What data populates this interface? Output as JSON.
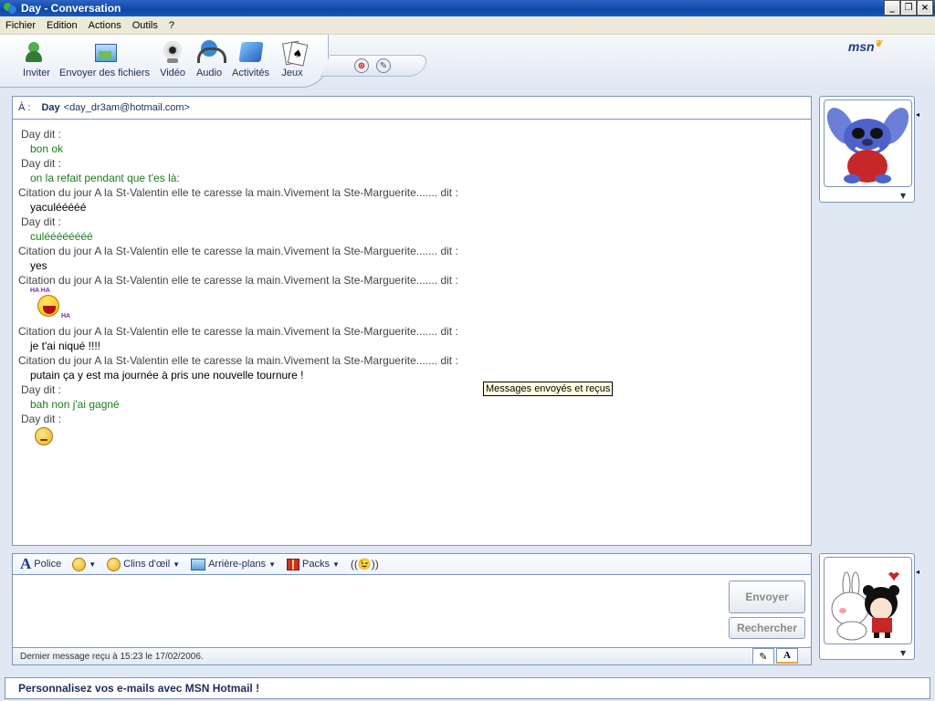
{
  "window": {
    "title": "Day - Conversation",
    "buttons": [
      "_",
      "❐",
      "×"
    ]
  },
  "menu": [
    "Fichier",
    "Edition",
    "Actions",
    "Outils",
    "?"
  ],
  "toolbar": {
    "items": [
      {
        "label": "Inviter",
        "icon": "invite-icon"
      },
      {
        "label": "Envoyer des fichiers",
        "icon": "send-files-icon"
      },
      {
        "label": "Vidéo",
        "icon": "webcam-icon"
      },
      {
        "label": "Audio",
        "icon": "headset-icon"
      },
      {
        "label": "Activités",
        "icon": "activities-icon"
      },
      {
        "label": "Jeux",
        "icon": "cards-icon"
      }
    ],
    "block_icon": "⊗",
    "pen_icon": "✎"
  },
  "brand": {
    "logo": "msn"
  },
  "to_bar": {
    "label": "À :",
    "name": "Day",
    "email": "<day_dr3am@hotmail.com>"
  },
  "history": [
    {
      "type": "sender",
      "who": "day",
      "text": "Day dit :"
    },
    {
      "type": "msg",
      "color": "green",
      "text": "bon ok"
    },
    {
      "type": "sender",
      "who": "day",
      "text": "Day dit :"
    },
    {
      "type": "msg",
      "color": "green",
      "text": "on la refait pendant que t'es là:"
    },
    {
      "type": "sender",
      "who": "me",
      "text": "Citation du jour A la St-Valentin elle te caresse la main.Vivement la Ste-Marguerite....... dit :"
    },
    {
      "type": "msg",
      "color": "black",
      "text": "yaculééééé"
    },
    {
      "type": "sender",
      "who": "day",
      "text": "Day dit :"
    },
    {
      "type": "msg",
      "color": "green",
      "text": "culéééééééé"
    },
    {
      "type": "sender",
      "who": "me",
      "text": "Citation du jour A la St-Valentin elle te caresse la main.Vivement la Ste-Marguerite....... dit :"
    },
    {
      "type": "msg",
      "color": "black",
      "text": "yes"
    },
    {
      "type": "sender",
      "who": "me",
      "text": "Citation du jour A la St-Valentin elle te caresse la main.Vivement la Ste-Marguerite....... dit :"
    },
    {
      "type": "emoticon",
      "name": "laughing-emoticon"
    },
    {
      "type": "sender",
      "who": "me",
      "text": "Citation du jour A la St-Valentin elle te caresse la main.Vivement la Ste-Marguerite....... dit :"
    },
    {
      "type": "msg",
      "color": "black",
      "text": "je t'ai niqué !!!!"
    },
    {
      "type": "sender",
      "who": "me",
      "text": "Citation du jour A la St-Valentin elle te caresse la main.Vivement la Ste-Marguerite....... dit :"
    },
    {
      "type": "msg",
      "color": "black",
      "text": "putain ça y est ma journée à pris une nouvelle tournure !"
    },
    {
      "type": "sender",
      "who": "day",
      "text": "Day dit :"
    },
    {
      "type": "msg",
      "color": "green",
      "text": "bah non j'ai gagné"
    },
    {
      "type": "sender",
      "who": "day",
      "text": "Day dit :"
    },
    {
      "type": "emoticon-small",
      "name": "smirk-emoticon"
    }
  ],
  "emoticon_text": {
    "ha1": "HA HA",
    "ha2": "HA"
  },
  "tooltip": "Messages envoyés et reçus",
  "format_bar": {
    "font": "Police",
    "winks": "Clins d'œil",
    "backgrounds": "Arrière-plans",
    "packs": "Packs",
    "nudge": "((😉))"
  },
  "buttons": {
    "send": "Envoyer",
    "search": "Rechercher"
  },
  "status": {
    "text": "Dernier message reçu à 15:23 le 17/02/2006."
  },
  "footer": {
    "text": "Personnalisez vos e-mails avec MSN Hotmail !"
  },
  "colors": {
    "sender_green": "#1a7c1a",
    "titlebar": "#0d47a6",
    "panel_border": "#7c95bb"
  }
}
